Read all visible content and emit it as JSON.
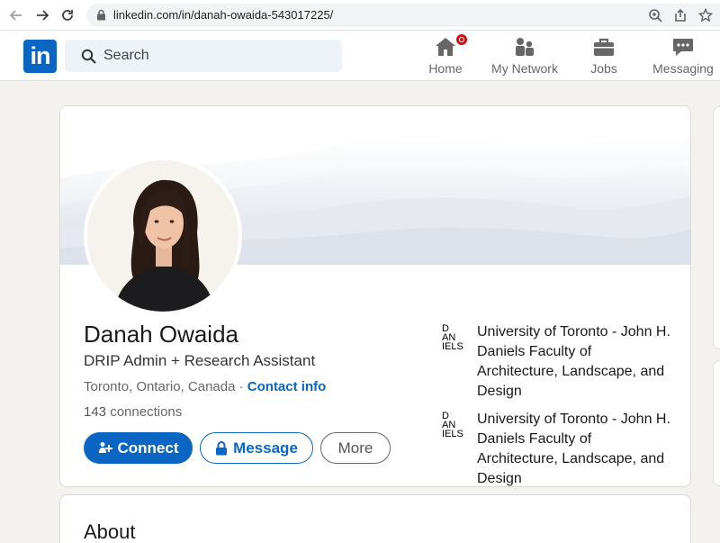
{
  "browser": {
    "url": "linkedin.com/in/danah-owaida-543017225/"
  },
  "header": {
    "search_placeholder": "Search",
    "nav": [
      {
        "label": "Home",
        "icon": "home-icon"
      },
      {
        "label": "My Network",
        "icon": "network-icon"
      },
      {
        "label": "Jobs",
        "icon": "briefcase-icon"
      },
      {
        "label": "Messaging",
        "icon": "messaging-icon"
      }
    ]
  },
  "profile": {
    "name": "Danah Owaida",
    "headline": "DRIP Admin + Research Assistant",
    "location": "Toronto, Ontario, Canada",
    "separator": " · ",
    "contact_info": "Contact info",
    "connections_count": "143",
    "connections_label": " connections",
    "buttons": {
      "connect": "Connect",
      "message": "Message",
      "more": "More"
    },
    "education": [
      {
        "logo_lines": [
          "D",
          "AN",
          "IELS"
        ],
        "school": "University of Toronto - John H. Daniels Faculty of Architecture, Landscape, and Design"
      },
      {
        "logo_lines": [
          "D",
          "AN",
          "IELS"
        ],
        "school": "University of Toronto - John H. Daniels Faculty of Architecture, Landscape, and Design"
      }
    ]
  },
  "about": {
    "title": "About"
  },
  "colors": {
    "brand": "#0a66c2",
    "badge": "#cc1016"
  }
}
